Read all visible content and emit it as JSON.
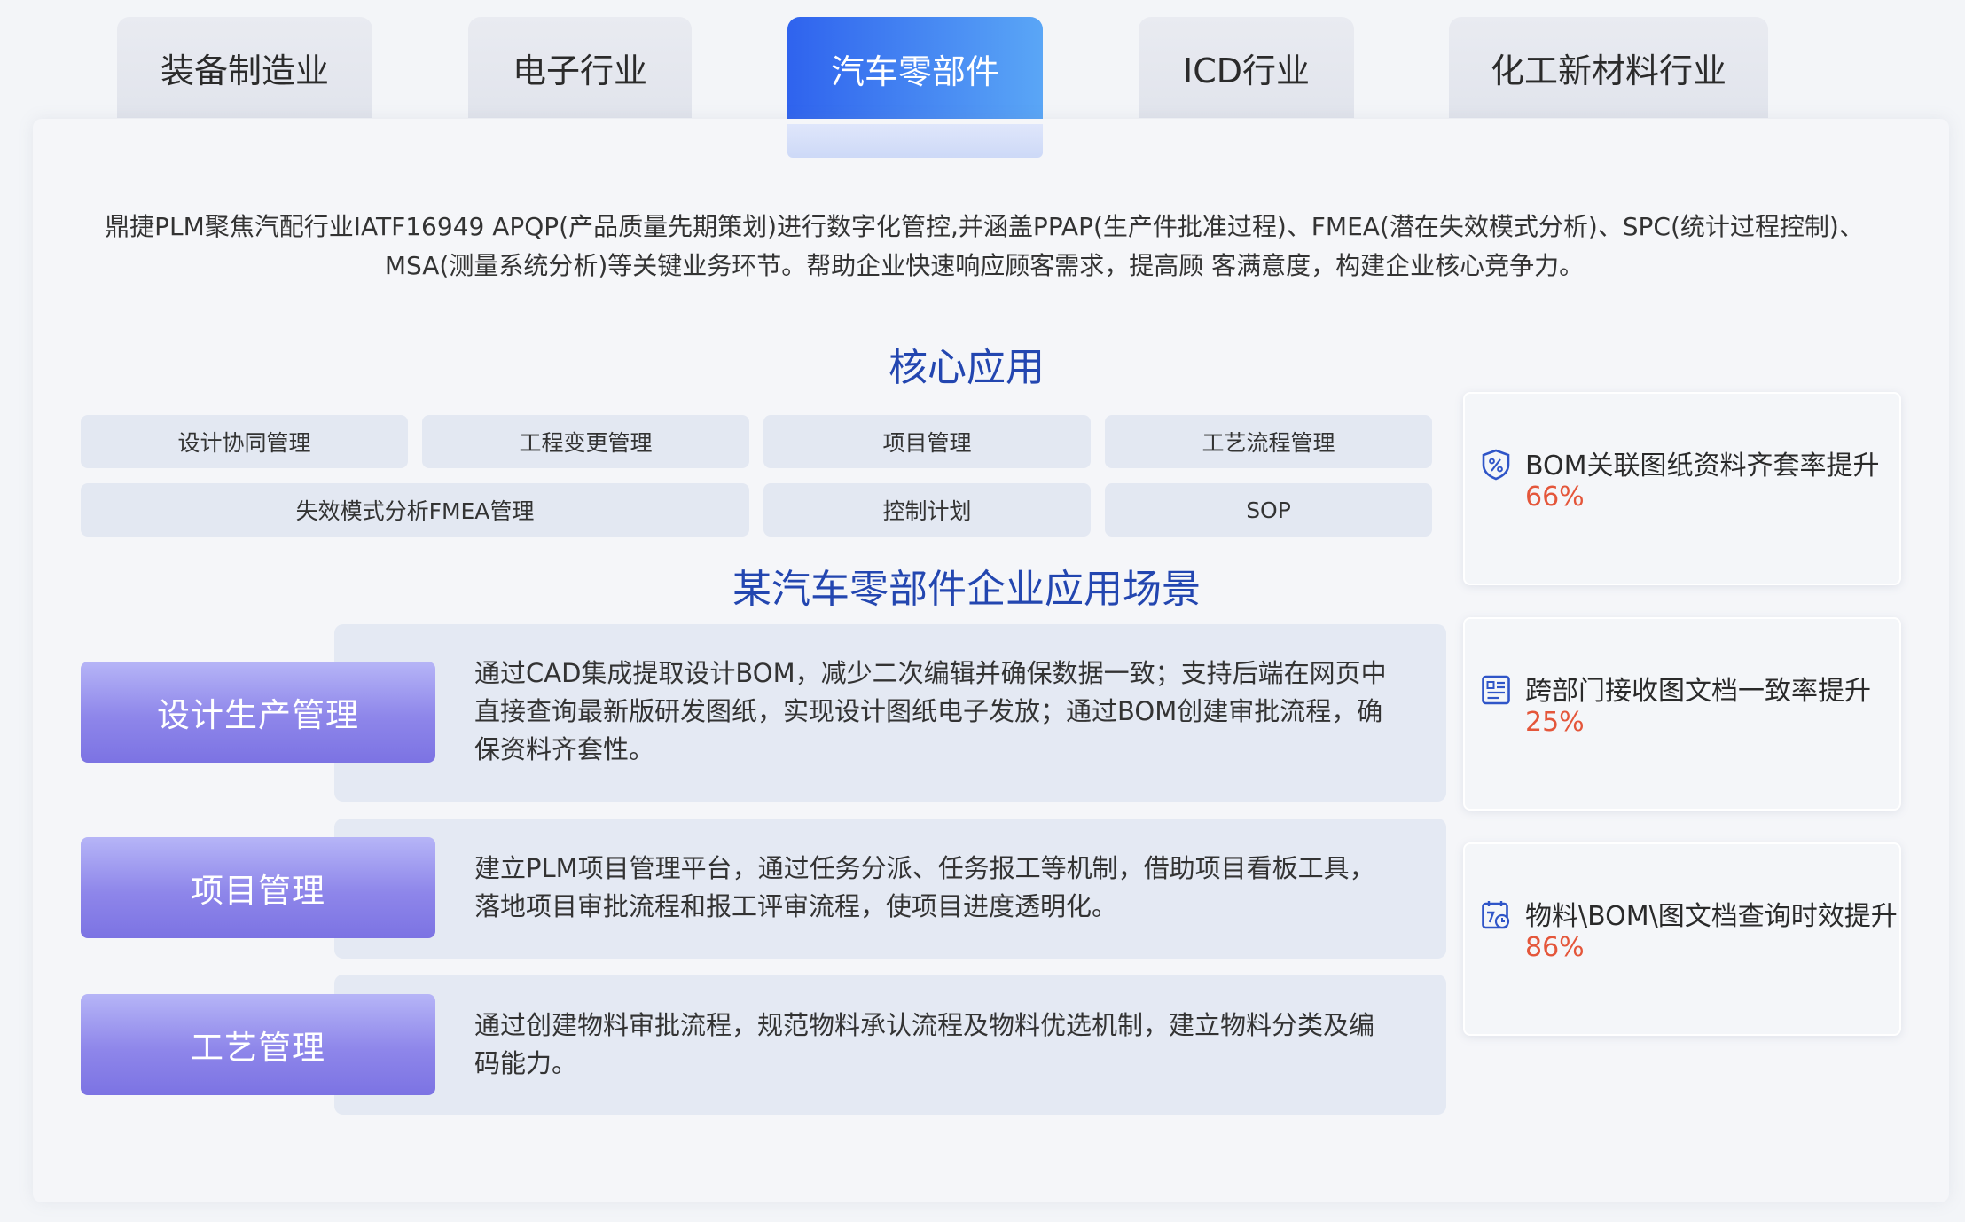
{
  "tabs": [
    {
      "label": "装备制造业",
      "active": false
    },
    {
      "label": "电子行业",
      "active": false
    },
    {
      "label": "汽车零部件",
      "active": true
    },
    {
      "label": "ICD行业",
      "active": false
    },
    {
      "label": "化工新材料行业",
      "active": false
    }
  ],
  "intro": {
    "line1": "鼎捷PLM聚焦汽配行业IATF16949 APQP(产品质量先期策划)进行数字化管控,并涵盖PPAP(生产件批准过程)、FMEA(潜在失效模式分析)、SPC(统计过程控制)、",
    "line2": "MSA(测量系统分析)等关键业务环节。帮助企业快速响应顾客需求，提高顾 客满意度，构建企业核心竞争力。"
  },
  "core": {
    "title": "核心应用",
    "apps": [
      "设计协同管理",
      "工程变更管理",
      "项目管理",
      "工艺流程管理",
      "失效模式分析FMEA管理",
      "控制计划",
      "SOP"
    ]
  },
  "scenarios": {
    "title": "某汽车零部件企业应用场景",
    "items": [
      {
        "label": "设计生产管理",
        "text": "通过CAD集成提取设计BOM，减少二次编辑并确保数据一致；支持后端在网页中直接查询最新版研发图纸，实现设计图纸电子发放；通过BOM创建审批流程，确保资料齐套性。"
      },
      {
        "label": "项目管理",
        "text": "建立PLM项目管理平台，通过任务分派、任务报工等机制，借助项目看板工具，落地项目审批流程和报工评审流程，使项目进度透明化。"
      },
      {
        "label": "工艺管理",
        "text": "通过创建物料审批流程，规范物料承认流程及物料优选机制，建立物料分类及编码能力。"
      }
    ]
  },
  "stats": [
    {
      "icon": "percent-shield-icon",
      "label": "BOM关联图纸资料齐套率提升",
      "value": "66%"
    },
    {
      "icon": "document-list-icon",
      "label": "跨部门接收图文档一致率提升",
      "value": "25%"
    },
    {
      "icon": "calendar-clock-icon",
      "label": "物料\\BOM\\图文档查询时效提升",
      "value": "86%"
    }
  ],
  "colors": {
    "accent": "#2f63ee",
    "title": "#2346b0",
    "stat_value": "#e4563a",
    "scenario_label": "#8e86ea"
  }
}
